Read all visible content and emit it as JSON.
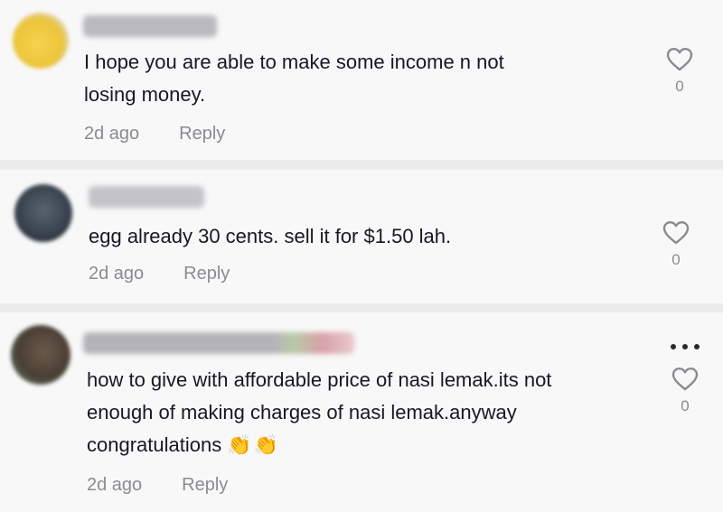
{
  "comments": [
    {
      "text": "I hope you are able to make some income n not\nlosing money.",
      "time": "2d ago",
      "reply_label": "Reply",
      "likes": "0",
      "avatar_icon": "avatar-blurred-yellow"
    },
    {
      "text": "egg already 30 cents. sell it for $1.50 lah.",
      "time": "2d ago",
      "reply_label": "Reply",
      "likes": "0",
      "avatar_icon": "avatar-blurred-dark"
    },
    {
      "text": "how to give with affordable price of nasi lemak.its not\nenough of making charges of nasi lemak.anyway\ncongratulations",
      "emoji": "👏👏",
      "time": "2d ago",
      "reply_label": "Reply",
      "likes": "0",
      "avatar_icon": "avatar-blurred-brown",
      "more_icon": "more-options-icon"
    }
  ],
  "colors": {
    "text": "#161823",
    "meta": "#8a8b91",
    "background": "#f8f8f8",
    "separator": "#ececec"
  },
  "icons": {
    "like": "heart-outline-icon"
  }
}
